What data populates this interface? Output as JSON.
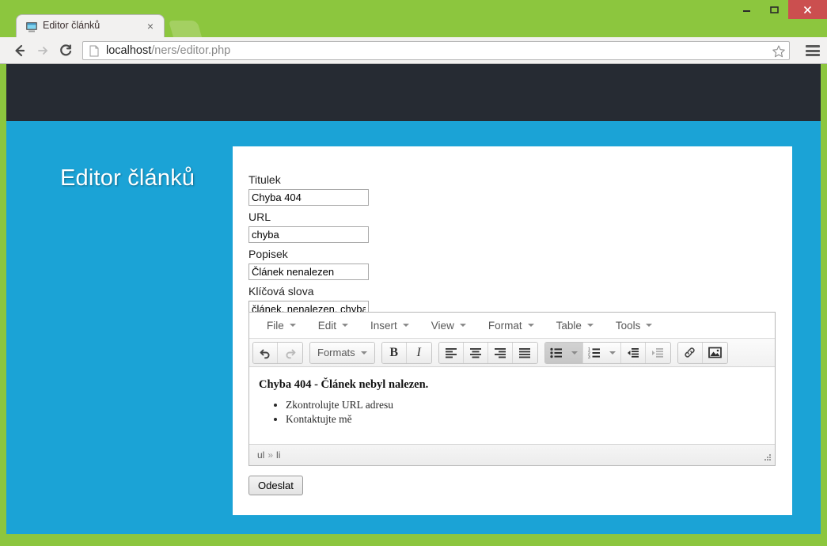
{
  "browser": {
    "tab": {
      "title": "Editor článků",
      "favicon": "computer-monitor-icon",
      "close_label": "×"
    },
    "new_tab_label": "",
    "nav": {
      "back": "back-arrow-icon",
      "forward": "forward-arrow-icon",
      "reload": "reload-icon"
    },
    "omnibox": {
      "host": "localhost",
      "path": "/ners/editor.php",
      "page_icon": "document-icon",
      "star": "bookmark-star-icon"
    },
    "menu": "hamburger-menu-icon",
    "window_controls": {
      "minimize": "minimize-icon",
      "maximize": "maximize-icon",
      "close": "close-icon"
    }
  },
  "page": {
    "heading": "Editor článků",
    "colors": {
      "frame": "#8cc63e",
      "header_bar": "#262b33",
      "body": "#1ba3d6",
      "card": "#ffffff",
      "close_button": "#cb4f4f"
    }
  },
  "form": {
    "fields": [
      {
        "label": "Titulek",
        "value": "Chyba 404",
        "name": "titulek"
      },
      {
        "label": "URL",
        "value": "chyba",
        "name": "url"
      },
      {
        "label": "Popisek",
        "value": "Článek nenalezen",
        "name": "popisek"
      },
      {
        "label": "Klíčová slova",
        "value": "článek, nenalezen, chyba",
        "name": "klicova-slova"
      }
    ],
    "submit_label": "Odeslat"
  },
  "editor": {
    "menubar": [
      {
        "label": "File"
      },
      {
        "label": "Edit"
      },
      {
        "label": "Insert"
      },
      {
        "label": "View"
      },
      {
        "label": "Format"
      },
      {
        "label": "Table"
      },
      {
        "label": "Tools"
      }
    ],
    "toolbar": {
      "undo": "undo-icon",
      "redo": "redo-icon",
      "formats_label": "Formats",
      "bold": "B",
      "italic": "I",
      "align_left": "align-left-icon",
      "align_center": "align-center-icon",
      "align_right": "align-right-icon",
      "align_justify": "align-justify-icon",
      "bullist": "bullet-list-icon",
      "numlist": "numbered-list-icon",
      "outdent": "outdent-icon",
      "indent": "indent-icon",
      "link": "link-icon",
      "image": "image-icon"
    },
    "content": {
      "heading": "Chyba 404 - Článek nebyl nalezen.",
      "list": [
        "Zkontrolujte URL adresu",
        "Kontaktujte mě"
      ]
    },
    "statusbar": {
      "path": [
        "ul",
        "li"
      ],
      "separator": "»",
      "resize": "resize-grip-icon"
    }
  }
}
